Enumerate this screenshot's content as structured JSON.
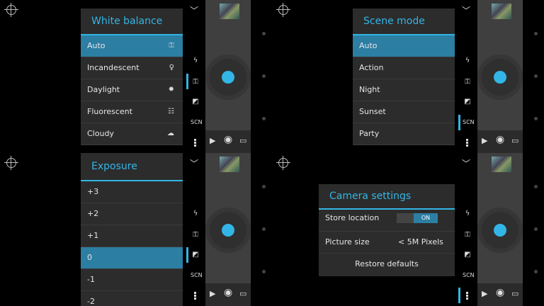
{
  "app": {
    "accent": "#33b5e5",
    "selected_bg": "#2c7ea3",
    "panel_bg": "#2c2c2c"
  },
  "white_balance": {
    "title": "White balance",
    "items": [
      {
        "label": "Auto",
        "icon": "awb-auto-icon",
        "selected": true
      },
      {
        "label": "Incandescent",
        "icon": "bulb-icon",
        "selected": false
      },
      {
        "label": "Daylight",
        "icon": "sun-icon",
        "selected": false
      },
      {
        "label": "Fluorescent",
        "icon": "fluorescent-icon",
        "selected": false
      },
      {
        "label": "Cloudy",
        "icon": "cloud-icon",
        "selected": false
      }
    ]
  },
  "scene_mode": {
    "title": "Scene mode",
    "items": [
      {
        "label": "Auto",
        "selected": true
      },
      {
        "label": "Action",
        "selected": false
      },
      {
        "label": "Night",
        "selected": false
      },
      {
        "label": "Sunset",
        "selected": false
      },
      {
        "label": "Party",
        "selected": false
      }
    ]
  },
  "exposure": {
    "title": "Exposure",
    "items": [
      {
        "label": "+3",
        "selected": false
      },
      {
        "label": "+2",
        "selected": false
      },
      {
        "label": "+1",
        "selected": false
      },
      {
        "label": "0",
        "selected": true
      },
      {
        "label": "-1",
        "selected": false
      },
      {
        "label": "-2",
        "selected": false
      }
    ]
  },
  "camera_settings": {
    "title": "Camera settings",
    "store_location": {
      "label": "Store location",
      "toggle": "ON"
    },
    "picture_size": {
      "label": "Picture size",
      "value": "< 5M Pixels"
    },
    "restore": "Restore defaults"
  },
  "strip": {
    "scene_label": "SCN",
    "icons": [
      "chevron-down-icon",
      "flash-off-icon",
      "awb-icon",
      "exposure-icon",
      "scene-icon",
      "menu-dots-icon"
    ]
  },
  "modes": [
    "video-icon",
    "camera-icon",
    "panorama-icon"
  ]
}
